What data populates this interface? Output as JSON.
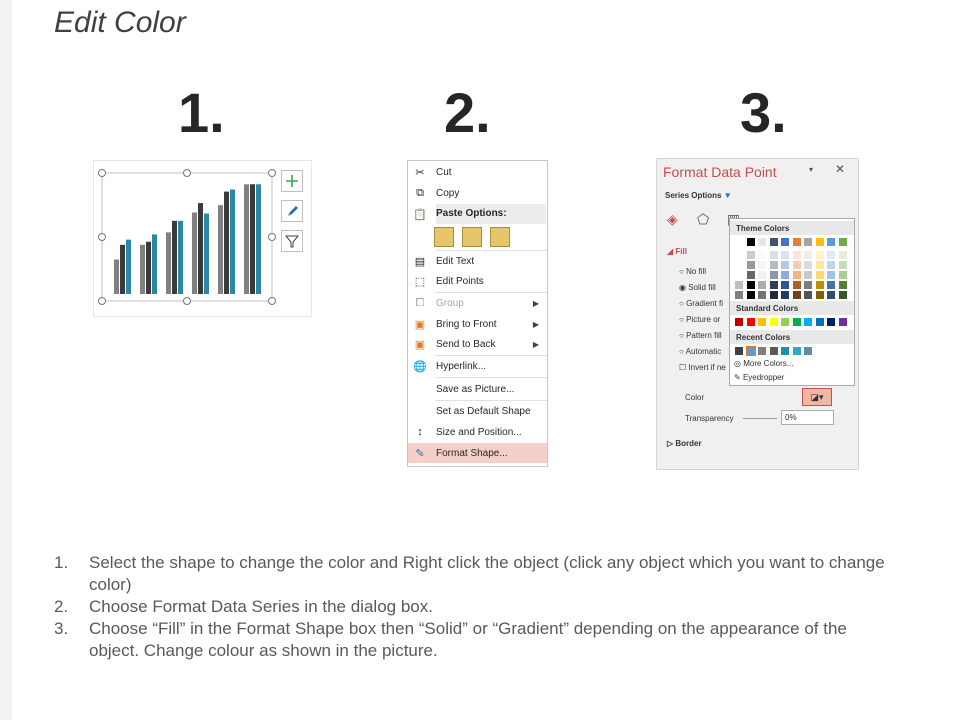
{
  "title": "Edit Color",
  "numbers": [
    "1.",
    "2.",
    "3."
  ],
  "context_menu": {
    "items": [
      {
        "label": "Cut",
        "icon": "scissors-icon"
      },
      {
        "label": "Copy",
        "icon": "copy-icon"
      },
      {
        "label": "Paste Options:",
        "icon": "paste-icon"
      },
      {
        "label": "Edit Text",
        "icon": "edit-text-icon"
      },
      {
        "label": "Edit Points",
        "icon": "edit-points-icon"
      },
      {
        "label": "Group",
        "icon": "group-icon"
      },
      {
        "label": "Bring to Front",
        "icon": "bring-front-icon"
      },
      {
        "label": "Send to Back",
        "icon": "send-back-icon"
      },
      {
        "label": "Hyperlink...",
        "icon": "hyperlink-icon"
      },
      {
        "label": "Save as Picture..."
      },
      {
        "label": "Set as Default Shape"
      },
      {
        "label": "Size and Position...",
        "icon": "size-position-icon"
      },
      {
        "label": "Format Shape...",
        "icon": "format-shape-icon"
      }
    ]
  },
  "format_pane": {
    "title": "Format Data Point",
    "series_options": "Series Options",
    "fill_section": "Fill",
    "fill_options": [
      "No fill",
      "Solid fill",
      "Gradient fi",
      "Picture or",
      "Pattern fill",
      "Automatic",
      "Invert if ne"
    ],
    "color_label": "Color",
    "transparency_label": "Transparency",
    "transparency_value": "0%",
    "border_section": "Border",
    "accent_color": "#c0504d"
  },
  "color_palette": {
    "theme_label": "Theme Colors",
    "standard_label": "Standard Colors",
    "recent_label": "Recent Colors",
    "more_colors": "More Colors...",
    "eyedropper": "Eyedropper",
    "theme_row": [
      "#ffffff",
      "#000000",
      "#e7e6e6",
      "#44546a",
      "#4472c4",
      "#ed7d31",
      "#a5a5a5",
      "#ffc000",
      "#5b9bd5",
      "#70ad47"
    ],
    "standard_row": [
      "#c00000",
      "#ff0000",
      "#ffc000",
      "#ffff00",
      "#92d050",
      "#00b050",
      "#00b0f0",
      "#0070c0",
      "#002060",
      "#7030a0"
    ],
    "recent_row": [
      "#404040",
      "#5b9bd5",
      "#7f7f7f",
      "#595959",
      "#1f8dac",
      "#31a7c7",
      "#5a8fa6"
    ]
  },
  "chart": {
    "series_colors": [
      "#808080",
      "#3a3a3a",
      "#2b86a8"
    ],
    "groups": [
      [
        0.33,
        0.47,
        0.52
      ],
      [
        0.47,
        0.5,
        0.57
      ],
      [
        0.59,
        0.7,
        0.7
      ],
      [
        0.78,
        0.87,
        0.77
      ],
      [
        0.85,
        0.98,
        1.0
      ],
      [
        1.05,
        1.05,
        1.05
      ]
    ]
  },
  "steps": [
    {
      "num": "1.",
      "text": "Select the shape to change the color and Right click the object (click any object which you want to change color)"
    },
    {
      "num": "2.",
      "text": "Choose Format Data Series in the dialog box."
    },
    {
      "num": "3.",
      "text": "Choose “Fill” in the Format Shape box then “Solid” or “Gradient” depending on the appearance of the object. Change colour as shown in the picture."
    }
  ]
}
